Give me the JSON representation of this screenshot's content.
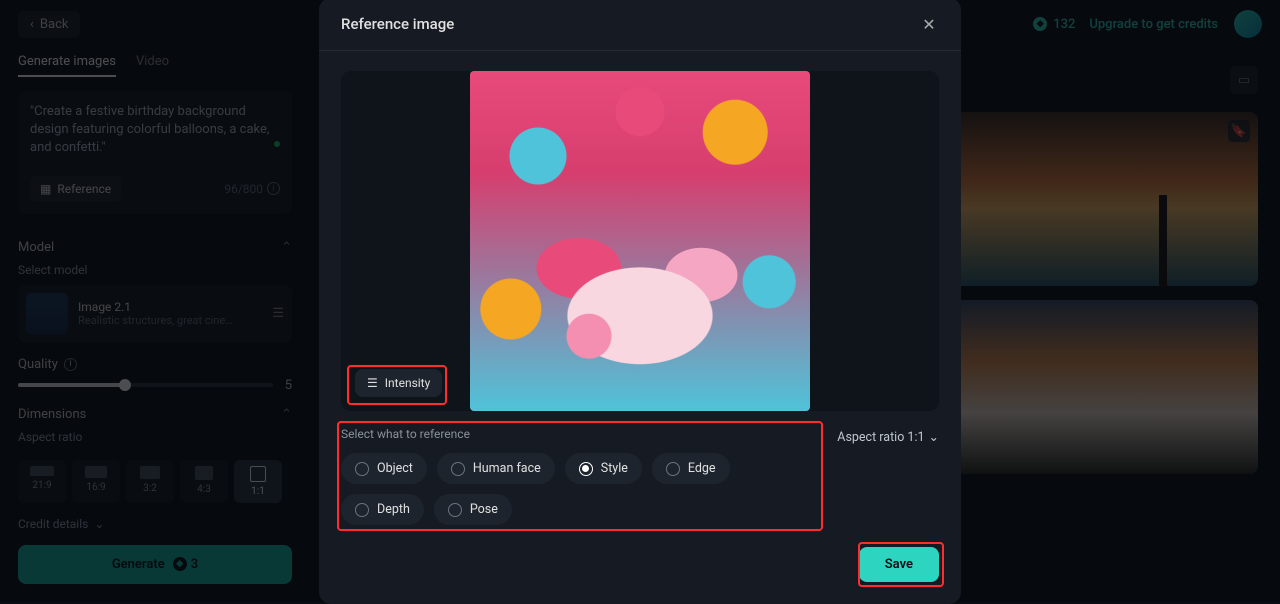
{
  "header": {
    "back_label": "Back",
    "credits_count": "132",
    "upgrade_label": "Upgrade to get credits"
  },
  "tabs": {
    "images": "Generate images",
    "video": "Video"
  },
  "prompt": {
    "text": "\"Create a festive birthday background design featuring colorful balloons, a cake, and confetti.\"",
    "reference_label": "Reference",
    "char_count": "96/800"
  },
  "model_section": {
    "header": "Model",
    "select_label": "Select model",
    "name": "Image 2.1",
    "desc": "Realistic structures, great cinematog..."
  },
  "quality": {
    "label": "Quality",
    "value": "5"
  },
  "dimensions": {
    "header": "Dimensions",
    "sub": "Aspect ratio",
    "options": [
      "21:9",
      "16:9",
      "3:2",
      "4:3",
      "1:1"
    ],
    "selected": "1:1"
  },
  "credit_details_label": "Credit details",
  "generate": {
    "label": "Generate",
    "cost": "3"
  },
  "modal": {
    "title": "Reference image",
    "intensity_label": "Intensity",
    "select_label": "Select what to reference",
    "options": [
      "Object",
      "Human face",
      "Style",
      "Edge",
      "Depth",
      "Pose"
    ],
    "selected": "Style",
    "aspect_label": "Aspect ratio 1:1",
    "save_label": "Save"
  },
  "colors": {
    "accent": "#2dd4bf",
    "highlight": "#ff2d2d"
  }
}
